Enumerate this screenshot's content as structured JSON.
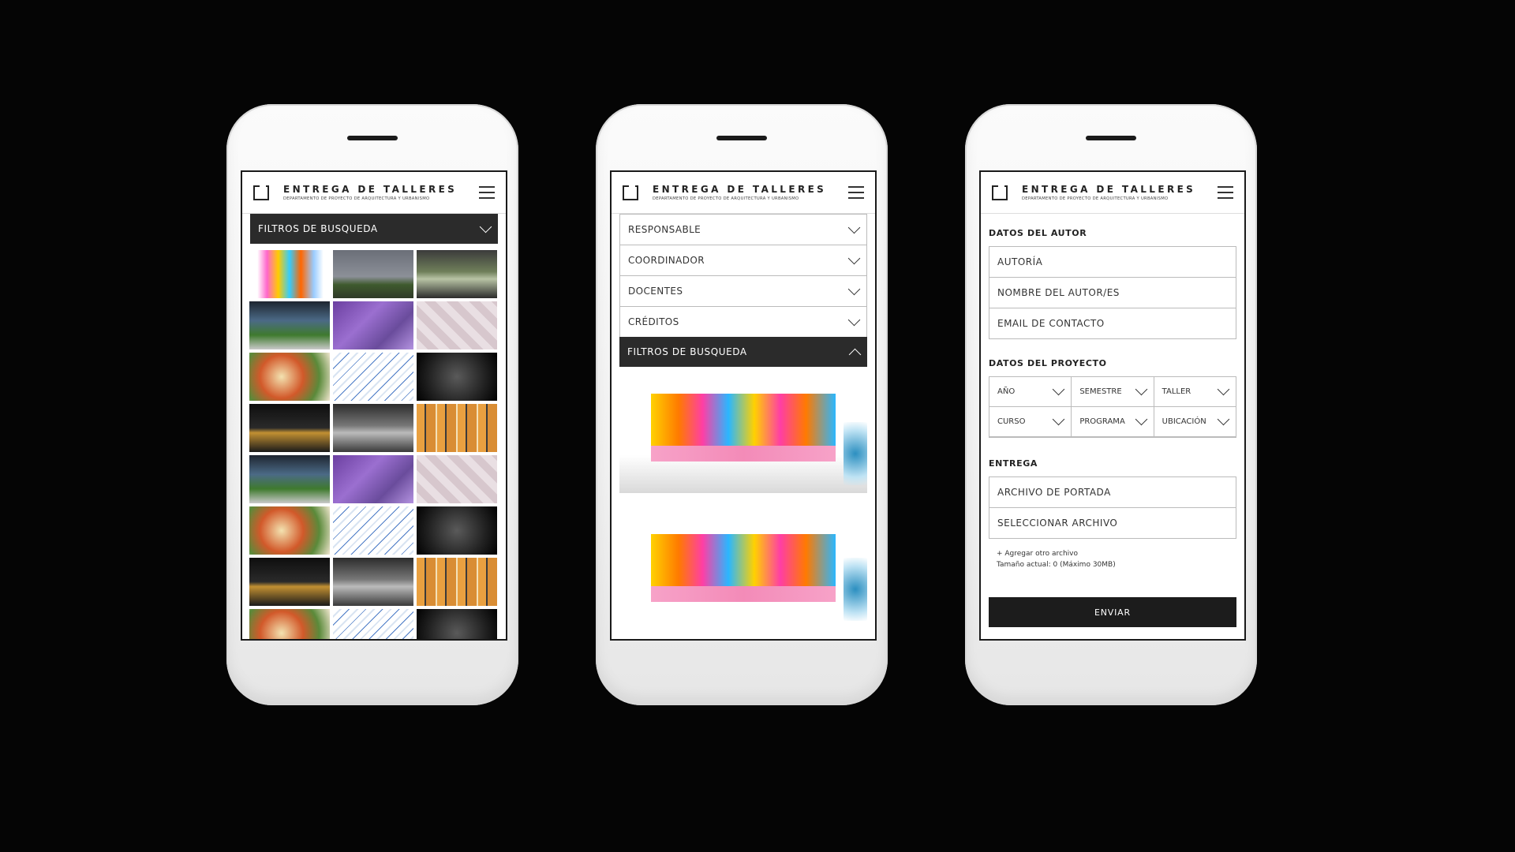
{
  "brand": {
    "title": "ENTREGA DE TALLERES",
    "subtitle": "DEPARTAMENTO DE PROYECTO DE ARQUITECTURA Y URBANISMO"
  },
  "phone1": {
    "filter_bar": "FILTROS DE BUSQUEDA"
  },
  "phone2": {
    "rows": [
      "RESPONSABLE",
      "COORDINADOR",
      "DOCENTES",
      "CRÉDITOS"
    ],
    "filter_bar": "FILTROS DE BUSQUEDA"
  },
  "phone3": {
    "author_section": "DATOS DEL AUTOR",
    "author_fields": [
      "AUTORÍA",
      "NOMBRE DEL AUTOR/ES",
      "EMAIL DE CONTACTO"
    ],
    "project_section": "DATOS DEL PROYECTO",
    "selects": [
      "AÑO",
      "SEMESTRE",
      "TALLER",
      "CURSO",
      "PROGRAMA",
      "UBICACIÓN"
    ],
    "delivery_section": "ENTREGA",
    "delivery_fields": [
      "ARCHIVO DE PORTADA",
      "SELECCIONAR ARCHIVO"
    ],
    "add_file": "+ Agregar otro archivo",
    "size_note": "Tamaño actual: 0 (Máximo 30MB)",
    "submit": "ENVIAR"
  },
  "colors": {
    "background": "#050505",
    "dark_bar": "#2b2b2b",
    "phone": "#f5f5f5"
  }
}
